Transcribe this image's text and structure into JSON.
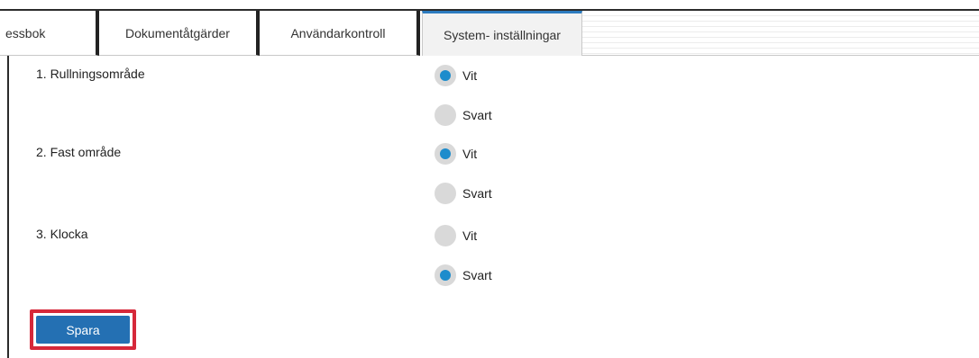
{
  "tabs": [
    {
      "label": "essbok",
      "active": false
    },
    {
      "label": "Dokumentåtgärder",
      "active": false
    },
    {
      "label": "Användarkontroll",
      "active": false
    },
    {
      "label": "System- inställningar",
      "active": true
    }
  ],
  "settings": [
    {
      "label": "1. Rullningsområde",
      "options": [
        {
          "label": "Vit",
          "checked": true
        },
        {
          "label": "Svart",
          "checked": false
        }
      ]
    },
    {
      "label": "2. Fast område",
      "options": [
        {
          "label": "Vit",
          "checked": true
        },
        {
          "label": "Svart",
          "checked": false
        }
      ]
    },
    {
      "label": "3. Klocka",
      "options": [
        {
          "label": "Vit",
          "checked": false
        },
        {
          "label": "Svart",
          "checked": true
        }
      ]
    }
  ],
  "save_label": "Spara",
  "colors": {
    "accent": "#2470b3",
    "radio_selected": "#1d8ccc",
    "highlight": "#d6283a"
  }
}
